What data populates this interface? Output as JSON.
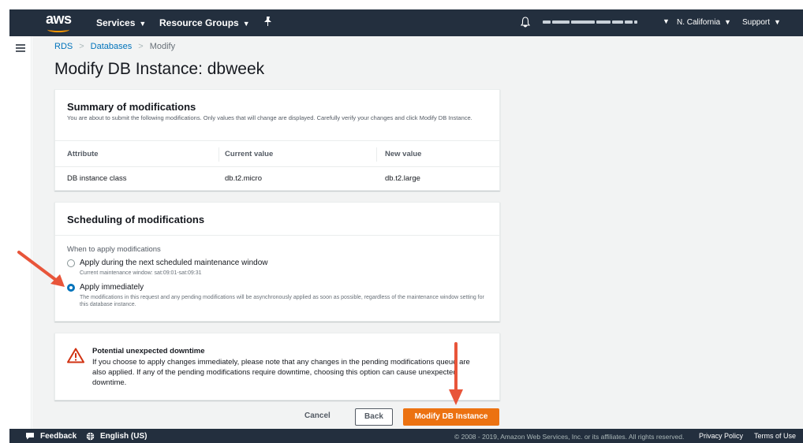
{
  "topnav": {
    "logo": "aws",
    "services": "Services",
    "resource_groups": "Resource Groups",
    "region": "N. California",
    "support": "Support"
  },
  "breadcrumb": {
    "rds": "RDS",
    "databases": "Databases",
    "current": "Modify"
  },
  "page_title": "Modify DB Instance: dbweek",
  "summary": {
    "title": "Summary of modifications",
    "description": "You are about to submit the following modifications. Only values that will change are displayed. Carefully verify your changes and click Modify DB Instance.",
    "columns": [
      "Attribute",
      "Current value",
      "New value"
    ],
    "rows": [
      {
        "attribute": "DB instance class",
        "current": "db.t2.micro",
        "new": "db.t2.large"
      }
    ]
  },
  "scheduling": {
    "title": "Scheduling of modifications",
    "when_label": "When to apply modifications",
    "options": [
      {
        "label": "Apply during the next scheduled maintenance window",
        "sub": "Current maintenance window: sat:09:01-sat:09:31",
        "selected": false
      },
      {
        "label": "Apply immediately",
        "sub": "The modifications in this request and any pending modifications will be asynchronously applied as soon as possible, regardless of the maintenance window setting for this database instance.",
        "selected": true
      }
    ]
  },
  "warning": {
    "title": "Potential unexpected downtime",
    "text": "If you choose to apply changes immediately, please note that any changes in the pending modifications queue are also applied. If any of the pending modifications require downtime, choosing this option can cause unexpected downtime."
  },
  "actions": {
    "cancel": "Cancel",
    "back": "Back",
    "modify": "Modify DB Instance"
  },
  "footer": {
    "feedback": "Feedback",
    "language": "English (US)",
    "copyright": "© 2008 - 2019, Amazon Web Services, Inc. or its affiliates. All rights reserved.",
    "privacy": "Privacy Policy",
    "terms": "Terms of Use"
  },
  "colors": {
    "nav_bg": "#232f3e",
    "accent_orange": "#ec7211",
    "link_blue": "#0073bb",
    "annotation_arrow": "#e8553a"
  }
}
